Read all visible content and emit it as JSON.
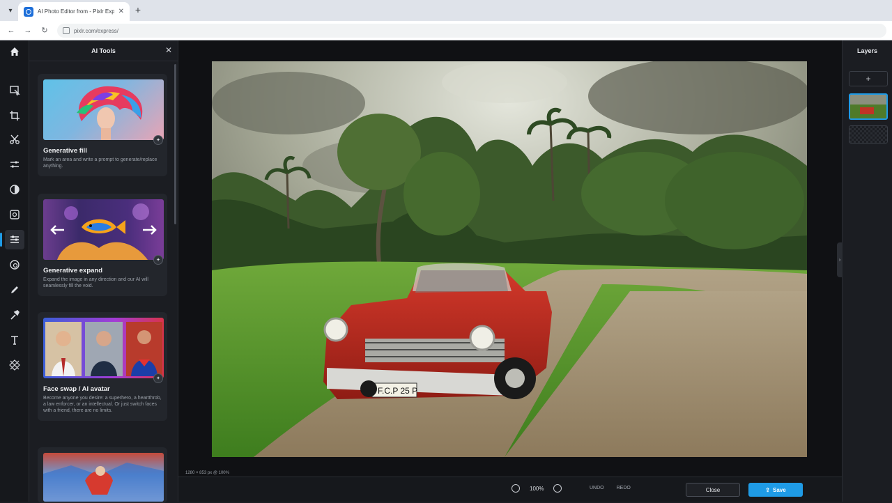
{
  "browser": {
    "tab_title": "AI Photo Editor from - Pixlr Exp...",
    "url": "pixlr.com/express/"
  },
  "tools_panel": {
    "title": "AI Tools",
    "cards": [
      {
        "title": "Generative fill",
        "desc": "Mark an area and write a prompt to generate/replace anything."
      },
      {
        "title": "Generative expand",
        "desc": "Expand the image in any direction and our AI will seamlessly fill the void."
      },
      {
        "title": "Face swap / AI avatar",
        "desc": "Become anyone you desire: a superhero, a heartthrob, a law enforcer, or an intellectual. Or just switch faces with a friend, there are no limits."
      }
    ]
  },
  "layers_panel": {
    "title": "Layers"
  },
  "canvas": {
    "info": "1280 × 853 px @ 100%"
  },
  "bottom_bar": {
    "zoom": "100%",
    "undo": "UNDO",
    "redo": "REDO",
    "close": "Close",
    "save": "Save"
  },
  "colors": {
    "accent": "#1f9be6",
    "panel": "#1b1d22",
    "canvas": "#101114"
  },
  "icons": [
    "home-icon",
    "arrange-icon",
    "crop-icon",
    "cutout-icon",
    "adjust-icon",
    "filter-icon",
    "effect-icon",
    "ai-tools-icon",
    "liquify-icon",
    "draw-icon",
    "retouch-icon",
    "text-icon",
    "pattern-icon"
  ]
}
